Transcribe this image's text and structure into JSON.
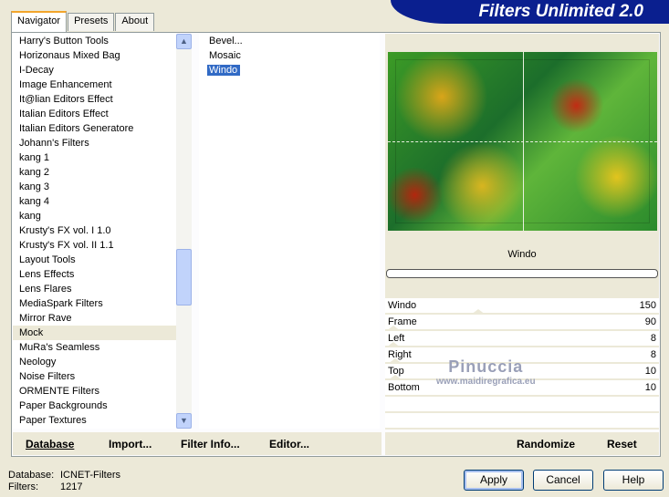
{
  "title": "Filters Unlimited 2.0",
  "tabs": [
    "Navigator",
    "Presets",
    "About"
  ],
  "categories": [
    "Harry's Button Tools",
    "Horizonaus Mixed Bag",
    "I-Decay",
    "Image Enhancement",
    "It@lian Editors Effect",
    "Italian Editors Effect",
    "Italian Editors Generatore",
    "Johann's Filters",
    "kang 1",
    "kang 2",
    "kang 3",
    "kang 4",
    "kang",
    "Krusty's FX vol. I 1.0",
    "Krusty's FX vol. II 1.1",
    "Layout Tools",
    "Lens Effects",
    "Lens Flares",
    "MediaSpark Filters",
    "Mirror Rave",
    "Mock",
    "MuRa's Seamless",
    "Neology",
    "Noise Filters",
    "ORMENTE Filters",
    "Paper Backgrounds",
    "Paper Textures"
  ],
  "selected_category": "Mock",
  "filters": [
    "Bevel...",
    "Mosaic",
    "Windo"
  ],
  "selected_filter": "Windo",
  "filter_title": "Windo",
  "slider_max": 255,
  "params": [
    {
      "label": "Windo",
      "value": 150
    },
    {
      "label": "Frame",
      "value": 90
    },
    {
      "label": "Left",
      "value": 8
    },
    {
      "label": "Right",
      "value": 8
    },
    {
      "label": "Top",
      "value": 10
    },
    {
      "label": "Bottom",
      "value": 10
    }
  ],
  "watermark": {
    "name": "Pinuccia",
    "url": "www.maidiregrafica.eu"
  },
  "bottom_buttons": {
    "database": "Database",
    "import": "Import...",
    "filter_info": "Filter Info...",
    "editor": "Editor...",
    "randomize": "Randomize",
    "reset": "Reset"
  },
  "status": {
    "database_label": "Database:",
    "database_value": "ICNET-Filters",
    "filters_label": "Filters:",
    "filters_value": "1217"
  },
  "dialog_buttons": {
    "apply": "Apply",
    "cancel": "Cancel",
    "help": "Help"
  }
}
